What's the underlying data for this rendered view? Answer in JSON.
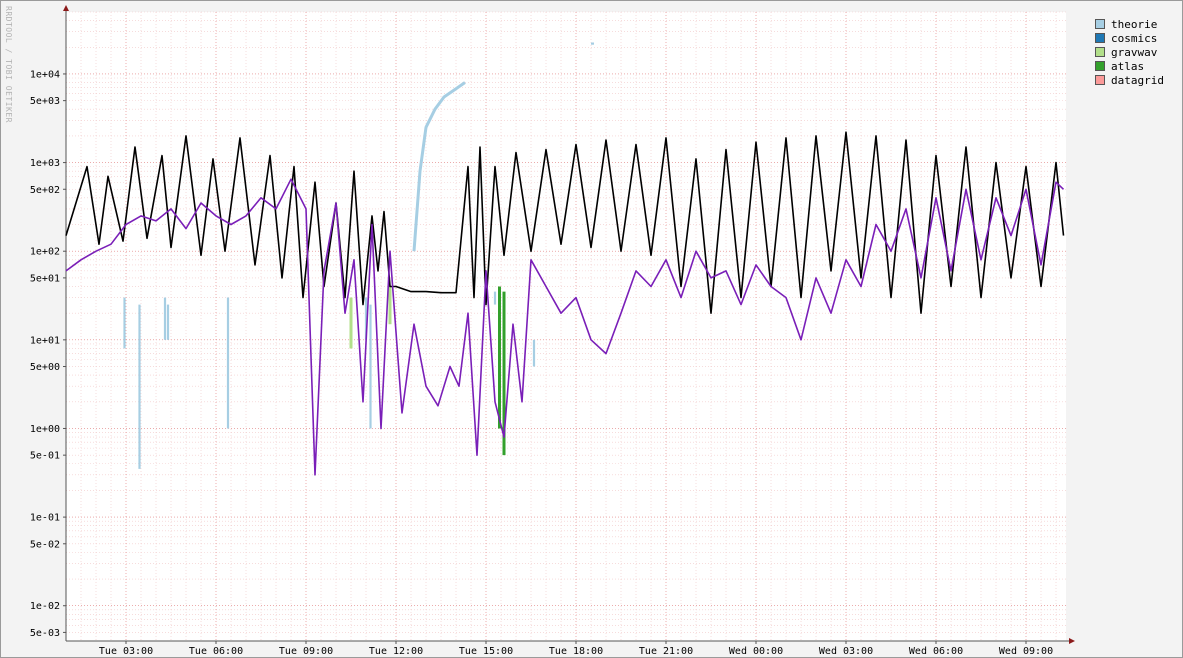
{
  "watermark": "RRDTOOL / TOBI OETIKER",
  "chart_data": {
    "type": "line",
    "yscale": "log",
    "ylim": [
      0.004,
      50000
    ],
    "xlim": [
      "Tue 01:00",
      "Wed 10:15"
    ],
    "grid": true,
    "ytick_labels": [
      {
        "label": "1e+04",
        "value": 10000
      },
      {
        "label": "5e+03",
        "value": 5000
      },
      {
        "label": "1e+03",
        "value": 1000
      },
      {
        "label": "5e+02",
        "value": 500
      },
      {
        "label": "1e+02",
        "value": 100
      },
      {
        "label": "5e+01",
        "value": 50
      },
      {
        "label": "1e+01",
        "value": 10
      },
      {
        "label": "5e+00",
        "value": 5
      },
      {
        "label": "1e+00",
        "value": 1
      },
      {
        "label": "5e-01",
        "value": 0.5
      },
      {
        "label": "1e-01",
        "value": 0.1
      },
      {
        "label": "5e-02",
        "value": 0.05
      },
      {
        "label": "1e-02",
        "value": 0.01
      },
      {
        "label": "5e-03",
        "value": 0.005
      }
    ],
    "xtick_labels": [
      "Tue 03:00",
      "Tue 06:00",
      "Tue 09:00",
      "Tue 12:00",
      "Tue 15:00",
      "Tue 18:00",
      "Tue 21:00",
      "Wed 00:00",
      "Wed 03:00",
      "Wed 06:00",
      "Wed 09:00"
    ],
    "legend": {
      "placement": "right",
      "entries": [
        {
          "name": "theorie",
          "color": "#a6cee3"
        },
        {
          "name": "cosmics",
          "color": "#1f78b4"
        },
        {
          "name": "gravwav",
          "color": "#b2df8a"
        },
        {
          "name": "atlas",
          "color": "#33a02c"
        },
        {
          "name": "datagrid",
          "color": "#fb9a99"
        }
      ]
    },
    "series": [
      {
        "color": "#000000",
        "x": [
          1.0,
          1.7,
          2.1,
          2.4,
          2.9,
          3.3,
          3.7,
          4.2,
          4.5,
          5.0,
          5.5,
          5.9,
          6.3,
          6.8,
          7.3,
          7.8,
          8.2,
          8.6,
          8.9,
          9.3,
          9.6,
          10.0,
          10.3,
          10.6,
          10.9,
          11.2,
          11.4,
          11.6,
          11.8,
          12.0,
          12.5,
          13.0,
          13.5,
          14.0,
          14.4,
          14.6,
          14.8,
          15.0,
          15.3,
          15.6,
          16.0,
          16.5,
          17.0,
          17.5,
          18.0,
          18.5,
          19.0,
          19.5,
          20.0,
          20.5,
          21.0,
          21.5,
          22.0,
          22.5,
          23.0,
          23.5,
          24.0,
          24.5,
          25.0,
          25.5,
          26.0,
          26.5,
          27.0,
          27.5,
          28.0,
          28.5,
          29.0,
          29.5,
          30.0,
          30.5,
          31.0,
          31.5,
          32.0,
          32.5,
          33.0,
          33.5,
          34.0,
          34.25
        ],
        "y": [
          150,
          900,
          120,
          700,
          130,
          1500,
          140,
          1200,
          110,
          2000,
          90,
          1100,
          100,
          1900,
          70,
          1200,
          50,
          900,
          30,
          600,
          40,
          350,
          30,
          800,
          25,
          250,
          60,
          280,
          40,
          40,
          35,
          35,
          34,
          34,
          900,
          30,
          1500,
          25,
          900,
          90,
          1300,
          100,
          1400,
          120,
          1600,
          110,
          1800,
          100,
          1600,
          90,
          1900,
          40,
          1100,
          20,
          1400,
          30,
          1700,
          40,
          1900,
          30,
          2000,
          60,
          2200,
          50,
          2000,
          30,
          1800,
          20,
          1200,
          40,
          1500,
          30,
          1000,
          50,
          900,
          40,
          1000,
          150
        ]
      },
      {
        "color": "#7a1fb8",
        "x": [
          1.0,
          1.5,
          2.0,
          2.5,
          3.0,
          3.5,
          4.0,
          4.5,
          5.0,
          5.5,
          6.0,
          6.5,
          7.0,
          7.5,
          8.0,
          8.5,
          9.0,
          9.3,
          9.6,
          10.0,
          10.3,
          10.6,
          10.9,
          11.2,
          11.5,
          11.8,
          12.2,
          12.6,
          13.0,
          13.4,
          13.8,
          14.1,
          14.4,
          14.7,
          15.0,
          15.3,
          15.6,
          15.9,
          16.2,
          16.5,
          17.0,
          17.5,
          18.0,
          18.5,
          19.0,
          19.5,
          20.0,
          20.5,
          21.0,
          21.5,
          22.0,
          22.5,
          23.0,
          23.5,
          24.0,
          24.5,
          25.0,
          25.5,
          26.0,
          26.5,
          27.0,
          27.5,
          28.0,
          28.5,
          29.0,
          29.5,
          30.0,
          30.5,
          31.0,
          31.5,
          32.0,
          32.5,
          33.0,
          33.5,
          34.0,
          34.25
        ],
        "y": [
          60,
          80,
          100,
          120,
          200,
          250,
          220,
          300,
          180,
          350,
          250,
          200,
          250,
          400,
          300,
          650,
          300,
          0.3,
          60,
          350,
          20,
          80,
          2,
          200,
          1,
          100,
          1.5,
          15,
          3,
          1.8,
          5,
          3,
          20,
          0.5,
          60,
          2,
          0.8,
          15,
          2,
          80,
          40,
          20,
          30,
          10,
          7,
          20,
          60,
          40,
          80,
          30,
          100,
          50,
          60,
          25,
          70,
          40,
          30,
          10,
          50,
          20,
          80,
          40,
          200,
          100,
          300,
          50,
          400,
          60,
          500,
          80,
          400,
          150,
          500,
          70,
          600,
          500
        ]
      },
      {
        "color": "#a6cee3",
        "x": [
          12.6,
          12.8,
          13.0,
          13.3,
          13.6,
          14.0,
          14.3
        ],
        "y": [
          100,
          800,
          2500,
          4000,
          5500,
          6800,
          8000
        ]
      }
    ]
  }
}
